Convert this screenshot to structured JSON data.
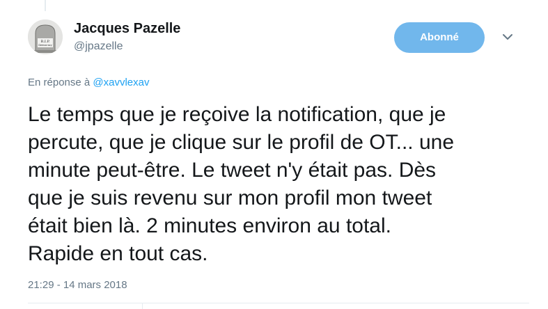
{
  "tweet": {
    "author": {
      "name": "Jacques Pazelle",
      "handle": "@jpazelle",
      "avatar_icon": "rip-gravestone-icon",
      "avatar_text_line1": "R.I.P.",
      "avatar_text_line2": "Democracy"
    },
    "follow_button_label": "Abonné",
    "menu_icon": "chevron-down-icon",
    "reply_prefix": "En réponse à",
    "reply_to_handle": "@xavvlexav",
    "text_lines": [
      "Le temps que je reçoive la notification, que je",
      "percute, que je clique sur le profil de OT... une",
      "minute peut-être. Le tweet n'y était pas. Dès",
      "que je suis revenu sur mon profil mon tweet",
      "était bien là. 2 minutes environ au total.",
      "Rapide en tout cas."
    ],
    "timestamp": "21:29 - 14 mars 2018"
  },
  "colors": {
    "follow_button_bg": "#71b7ec",
    "link": "#1da1f2",
    "muted": "#657786",
    "text": "#14171a",
    "divider": "#e6ecf0"
  }
}
